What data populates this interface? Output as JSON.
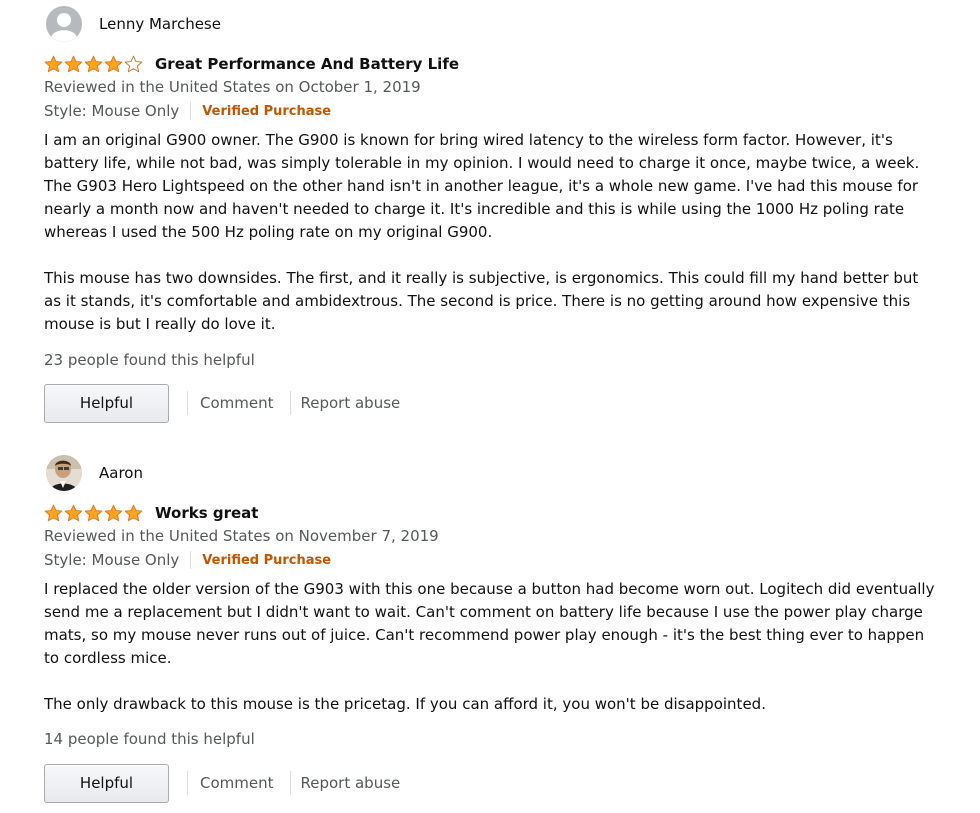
{
  "reviews": [
    {
      "profile_name": "Lenny Marchese",
      "avatar": "default-avatar",
      "rating": 4,
      "max_rating": 5,
      "title": "Great Performance And Battery Life",
      "date": "Reviewed in the United States on October 1, 2019",
      "style": "Style: Mouse Only",
      "verified": "Verified Purchase",
      "body": [
        "I am an original G900 owner. The G900 is known for bring wired latency to the wireless form factor. However, it's battery life, while not bad, was simply tolerable in my opinion. I would need to charge it once, maybe twice, a week. The G903 Hero Lightspeed on the other hand isn't in another league, it's a whole new game. I've had this mouse for nearly a month now and haven't needed to charge it. It's incredible and this is while using the 1000 Hz poling rate whereas I used the 500 Hz poling rate on my original G900.",
        "This mouse has two downsides. The first, and it really is subjective, is ergonomics. This could fill my hand better but as it stands, it's comfortable and ambidextrous. The second is price. There is no getting around how expensive this mouse is but I really do love it."
      ],
      "helpful_text": "23 people found this helpful",
      "helpful_button": "Helpful",
      "comment_link": "Comment",
      "report_link": "Report abuse"
    },
    {
      "profile_name": "Aaron",
      "avatar": "profile-photo",
      "rating": 5,
      "max_rating": 5,
      "title": "Works great",
      "date": "Reviewed in the United States on November 7, 2019",
      "style": "Style: Mouse Only",
      "verified": "Verified Purchase",
      "body": [
        "I replaced the older version of the G903 with this one because a button had become worn out. Logitech did eventually send me a replacement but I didn't want to wait. Can't comment on battery life because I use the power play charge mats, so my mouse never runs out of juice. Can't recommend power play enough - it's the best thing ever to happen to cordless mice.",
        "The only drawback to this mouse is the pricetag. If you can afford it, you won't be disappointed."
      ],
      "helpful_text": "14 people found this helpful",
      "helpful_button": "Helpful",
      "comment_link": "Comment",
      "report_link": "Report abuse"
    }
  ],
  "colors": {
    "star_fill": "#ffa41c",
    "star_stroke": "#de7921",
    "star_empty": "#ffffff",
    "verified": "#c45500",
    "muted_text": "#565959"
  }
}
